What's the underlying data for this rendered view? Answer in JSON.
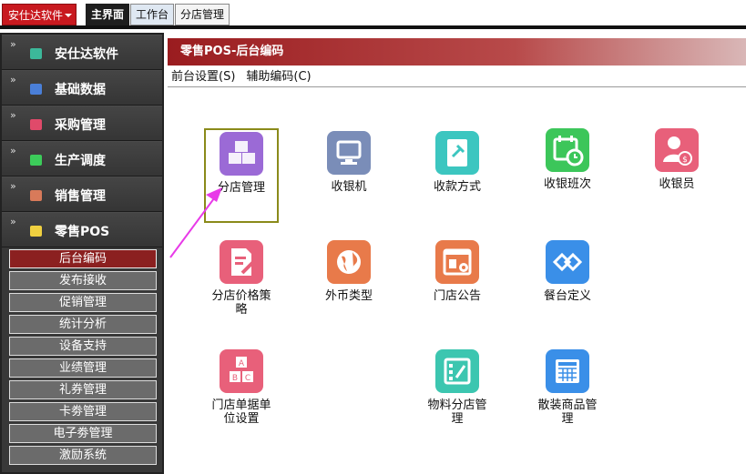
{
  "topbar": {
    "brand": "安仕达软件",
    "tabs": [
      "主界面",
      "工作台",
      "分店管理"
    ]
  },
  "sidebar": {
    "groups": [
      {
        "label": "安仕达软件",
        "icon": "cube-teal-icon",
        "color": "#3cb89a"
      },
      {
        "label": "基础数据",
        "icon": "cube-blue-icon",
        "color": "#4a7fd8"
      },
      {
        "label": "采购管理",
        "icon": "cube-pink-icon",
        "color": "#e04a6a"
      },
      {
        "label": "生产调度",
        "icon": "cube-green-icon",
        "color": "#3ccc5a"
      },
      {
        "label": "销售管理",
        "icon": "cube-brown-icon",
        "color": "#d87a5a"
      },
      {
        "label": "零售POS",
        "icon": "cube-yellow-icon",
        "color": "#f0d040"
      }
    ],
    "sub_items": [
      "后台编码",
      "发布接收",
      "促销管理",
      "统计分析",
      "设备支持",
      "业绩管理",
      "礼券管理",
      "卡劵管理",
      "电子劵管理",
      "激励系统"
    ]
  },
  "main": {
    "title": "零售POS-后台编码",
    "menus": [
      "前台设置(S)",
      "辅助编码(C)"
    ],
    "apps": [
      {
        "name": "分店管理",
        "icon": "cubes-icon",
        "color": "#9b6ad6"
      },
      {
        "name": "收银机",
        "icon": "monitor-icon",
        "color": "#7a8db8"
      },
      {
        "name": "收款方式",
        "icon": "pin-card-icon",
        "color": "#3cc6c0"
      },
      {
        "name": "收银班次",
        "icon": "calendar-clock-icon",
        "color": "#3cc65a"
      },
      {
        "name": "收银员",
        "icon": "user-coin-icon",
        "color": "#e8607a"
      },
      {
        "name": "分店价格策略",
        "icon": "document-edit-icon",
        "color": "#e8607a"
      },
      {
        "name": "外币类型",
        "icon": "globe-icon",
        "color": "#e87a4a"
      },
      {
        "name": "门店公告",
        "icon": "browser-gear-icon",
        "color": "#e87a4a"
      },
      {
        "name": "餐台定义",
        "icon": "diamond-link-icon",
        "color": "#3a8fe8"
      },
      {
        "name": "门店单据单位设置",
        "icon": "abc-blocks-icon",
        "color": "#e8607a"
      },
      {
        "name": "物料分店管理",
        "icon": "grid-edit-icon",
        "color": "#3cc6b0"
      },
      {
        "name": "散装商品管理",
        "icon": "table-grid-icon",
        "color": "#3a8fe8"
      }
    ]
  },
  "colors": {
    "accent": "#c8191f",
    "header": "#9a1c1f",
    "selection": "#8a8a1a",
    "arrow": "#e83ae8"
  }
}
